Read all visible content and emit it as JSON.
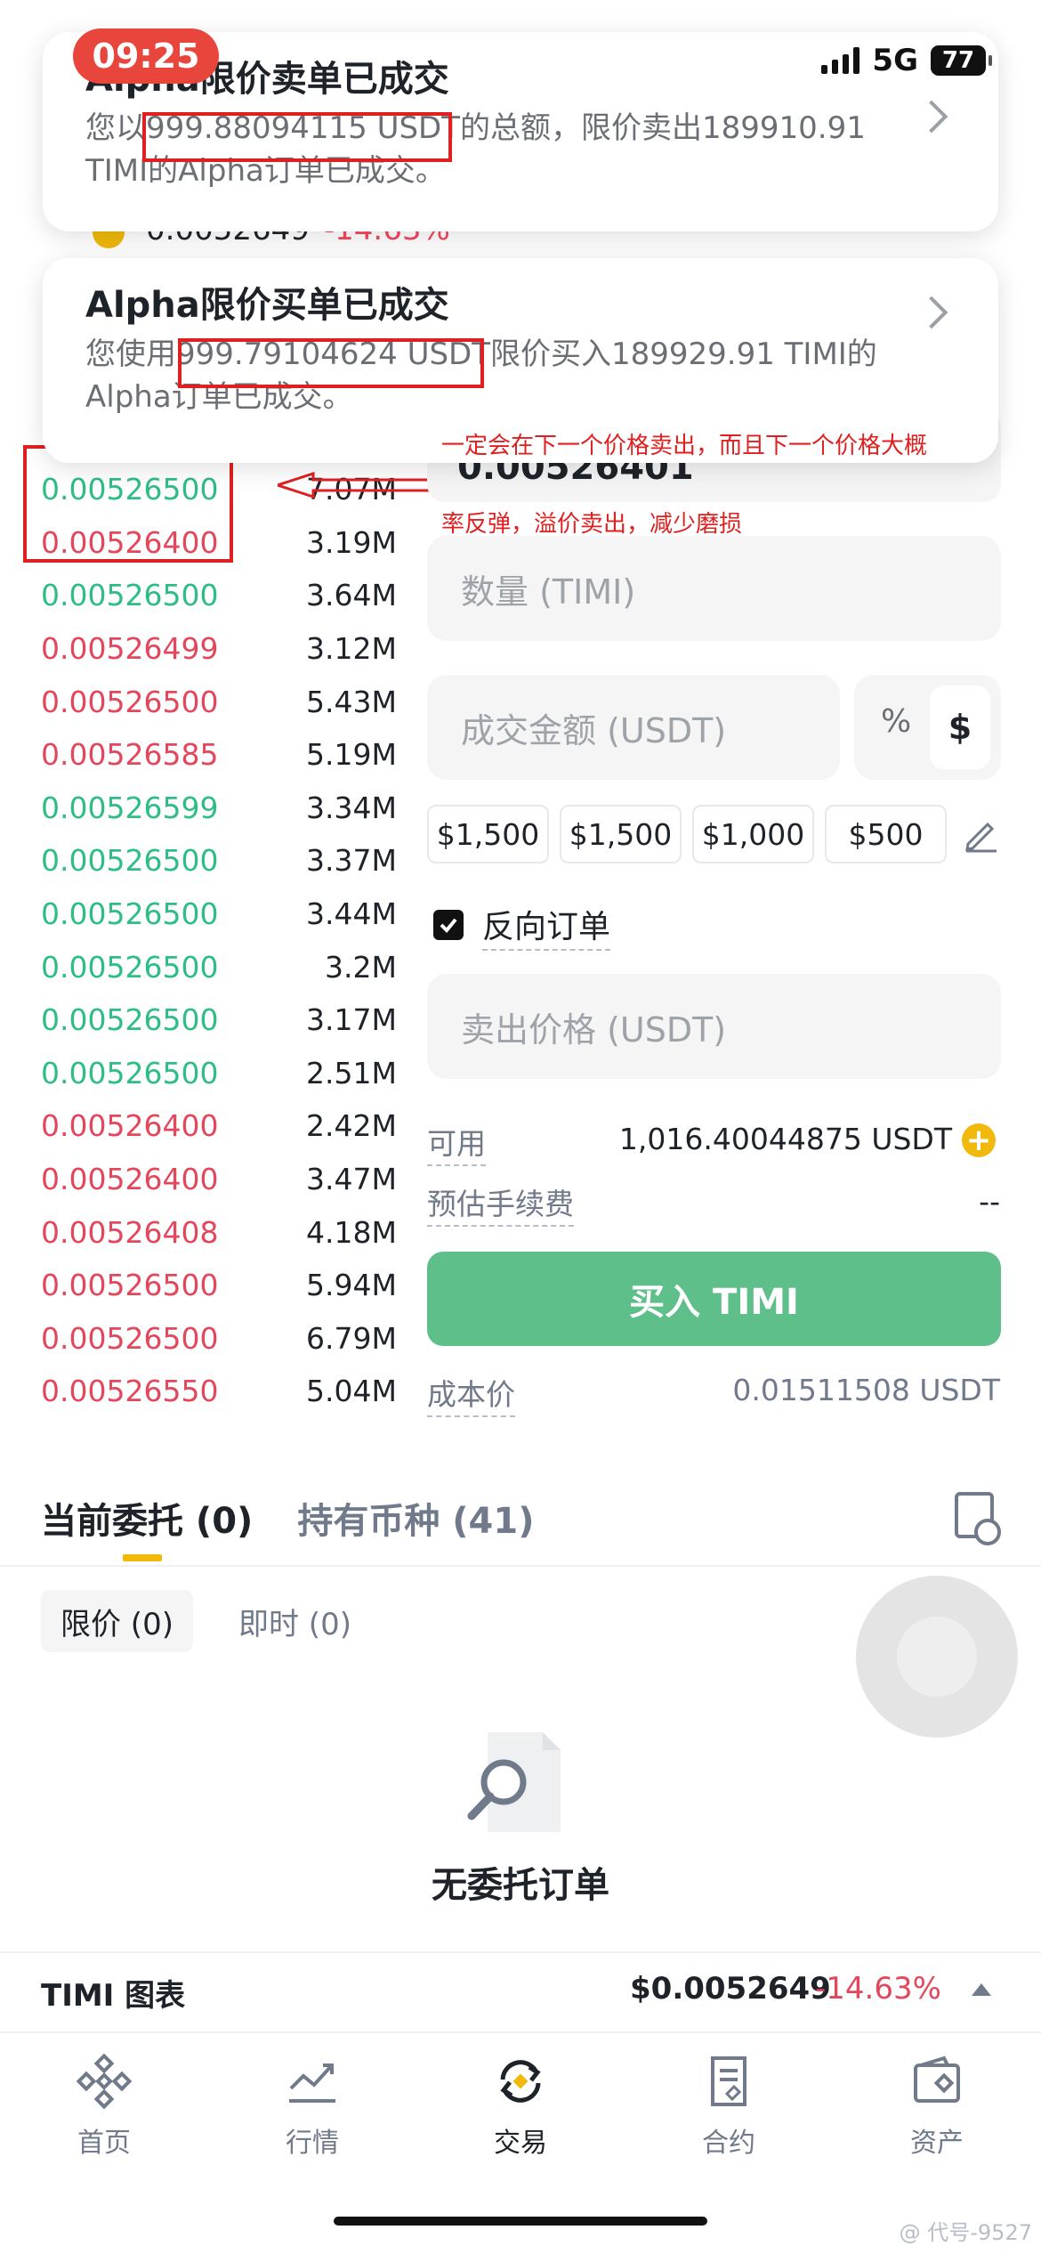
{
  "status_bar": {
    "time": "09:25",
    "network": "5G",
    "battery": "77"
  },
  "notifications": [
    {
      "title": "Alpha限价卖单已成交",
      "line1": "您以999.88094115 USDT的总额，限价卖出189910.91",
      "line2": "TIMI的Alpha订单已成交。"
    },
    {
      "title": "Alpha限价买单已成交",
      "line1": "您使用999.79104624 USDT限价买入189929.91 TIMI的",
      "line2": "Alpha订单已成交。"
    }
  ],
  "ticker_under": {
    "price": "0.0052649",
    "change": "-14.63%"
  },
  "annotation": {
    "line1": "一定会在下一个价格卖出，而且下一个价格大概",
    "line2": "率反弹，溢价卖出，减少磨损"
  },
  "order_book": [
    {
      "price": "0.00526500",
      "qty": "7.07M",
      "side": "g"
    },
    {
      "price": "0.00526400",
      "qty": "3.19M",
      "side": "r"
    },
    {
      "price": "0.00526500",
      "qty": "3.64M",
      "side": "g"
    },
    {
      "price": "0.00526499",
      "qty": "3.12M",
      "side": "r"
    },
    {
      "price": "0.00526500",
      "qty": "5.43M",
      "side": "r"
    },
    {
      "price": "0.00526585",
      "qty": "5.19M",
      "side": "r"
    },
    {
      "price": "0.00526599",
      "qty": "3.34M",
      "side": "g"
    },
    {
      "price": "0.00526500",
      "qty": "3.37M",
      "side": "g"
    },
    {
      "price": "0.00526500",
      "qty": "3.44M",
      "side": "g"
    },
    {
      "price": "0.00526500",
      "qty": "3.2M",
      "side": "g"
    },
    {
      "price": "0.00526500",
      "qty": "3.17M",
      "side": "g"
    },
    {
      "price": "0.00526500",
      "qty": "2.51M",
      "side": "g"
    },
    {
      "price": "0.00526400",
      "qty": "2.42M",
      "side": "r"
    },
    {
      "price": "0.00526400",
      "qty": "3.47M",
      "side": "r"
    },
    {
      "price": "0.00526408",
      "qty": "4.18M",
      "side": "r"
    },
    {
      "price": "0.00526500",
      "qty": "5.94M",
      "side": "r"
    },
    {
      "price": "0.00526500",
      "qty": "6.79M",
      "side": "r"
    },
    {
      "price": "0.00526550",
      "qty": "5.04M",
      "side": "r"
    }
  ],
  "form": {
    "price_value": "0.00526401",
    "qty_placeholder": "数量 (TIMI)",
    "total_placeholder": "成交金额 (USDT)",
    "unit_pct": "%",
    "unit_usd": "$",
    "amounts": [
      "$1,500",
      "$1,500",
      "$1,000",
      "$500"
    ],
    "reverse_order_label": "反向订单",
    "sell_price_placeholder": "卖出价格 (USDT)",
    "available_label": "可用",
    "available_value": "1,016.40044875 USDT",
    "fee_label": "预估手续费",
    "fee_value": "--",
    "buy_button": "买入 TIMI",
    "cost_label": "成本价",
    "cost_value": "0.01511508 USDT"
  },
  "orders": {
    "tabs": [
      "当前委托 (0)",
      "持有币种 (41)"
    ],
    "subtabs": [
      "限价 (0)",
      "即时 (0)"
    ],
    "empty_text": "无委托订单"
  },
  "chart_bar": {
    "title": "TIMI 图表",
    "price": "$0.0052649",
    "change": "-14.63%"
  },
  "nav": [
    {
      "label": "首页",
      "icon": "home-icon"
    },
    {
      "label": "行情",
      "icon": "markets-icon"
    },
    {
      "label": "交易",
      "icon": "trade-icon"
    },
    {
      "label": "合约",
      "icon": "futures-icon"
    },
    {
      "label": "资产",
      "icon": "wallet-icon"
    }
  ],
  "watermark": "@ 代号-9527",
  "colors": {
    "accent": "#f0b90b",
    "buy": "#5fbf8b",
    "up": "#2ebd85",
    "down": "#e2475c",
    "annotation": "#e02020"
  }
}
